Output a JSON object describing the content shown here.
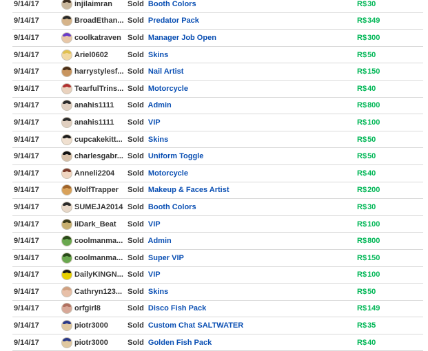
{
  "colors": {
    "item_link": "#0a4fb3",
    "robux": "#02b757",
    "divider": "#d9d9d9"
  },
  "sales": [
    {
      "date": "9/14/17",
      "user": "injilaimran",
      "action": "Sold",
      "item": "Booth Colors",
      "currency": "R$",
      "amount": "30",
      "avatar": {
        "skin": "#c9b79c",
        "hair": "#3b2d20"
      }
    },
    {
      "date": "9/14/17",
      "user": "BroadEthan...",
      "action": "Sold",
      "item": "Predator Pack",
      "currency": "R$",
      "amount": "349",
      "avatar": {
        "skin": "#d6b48a",
        "hair": "#2a2a2a"
      }
    },
    {
      "date": "9/14/17",
      "user": "coolkatraven",
      "action": "Sold",
      "item": "Manager Job Open",
      "currency": "R$",
      "amount": "300",
      "avatar": {
        "skin": "#e8c7a7",
        "hair": "#6a3ec9"
      }
    },
    {
      "date": "9/14/17",
      "user": "Ariel0602",
      "action": "Sold",
      "item": "Skins",
      "currency": "R$",
      "amount": "50",
      "avatar": {
        "skin": "#f2d8a0",
        "hair": "#e0c050"
      }
    },
    {
      "date": "9/14/17",
      "user": "harrystylesf...",
      "action": "Sold",
      "item": "Nail Artist",
      "currency": "R$",
      "amount": "150",
      "avatar": {
        "skin": "#c8955f",
        "hair": "#4a2f18"
      }
    },
    {
      "date": "9/14/17",
      "user": "TearfulTrins...",
      "action": "Sold",
      "item": "Motorcycle",
      "currency": "R$",
      "amount": "40",
      "avatar": {
        "skin": "#ead2be",
        "hair": "#b03030"
      }
    },
    {
      "date": "9/14/17",
      "user": "anahis1111",
      "action": "Sold",
      "item": "Admin",
      "currency": "R$",
      "amount": "800",
      "avatar": {
        "skin": "#e0cfc0",
        "hair": "#2b2b2b"
      }
    },
    {
      "date": "9/14/17",
      "user": "anahis1111",
      "action": "Sold",
      "item": "VIP",
      "currency": "R$",
      "amount": "100",
      "avatar": {
        "skin": "#e0cfc0",
        "hair": "#2b2b2b"
      }
    },
    {
      "date": "9/14/17",
      "user": "cupcakekitt...",
      "action": "Sold",
      "item": "Skins",
      "currency": "R$",
      "amount": "50",
      "avatar": {
        "skin": "#f0e0d0",
        "hair": "#1d1d1d"
      }
    },
    {
      "date": "9/14/17",
      "user": "charlesgabr...",
      "action": "Sold",
      "item": "Uniform Toggle",
      "currency": "R$",
      "amount": "50",
      "avatar": {
        "skin": "#d8c0a8",
        "hair": "#111111"
      }
    },
    {
      "date": "9/14/17",
      "user": "Anneli2204",
      "action": "Sold",
      "item": "Motorcycle",
      "currency": "R$",
      "amount": "40",
      "avatar": {
        "skin": "#f0d5c0",
        "hair": "#7a3a2a"
      }
    },
    {
      "date": "9/14/17",
      "user": "WolfTrapper",
      "action": "Sold",
      "item": "Makeup & Faces Artist",
      "currency": "R$",
      "amount": "200",
      "avatar": {
        "skin": "#d9a25a",
        "hair": "#a0642a"
      }
    },
    {
      "date": "9/14/17",
      "user": "SUMEJA2014",
      "action": "Sold",
      "item": "Booth Colors",
      "currency": "R$",
      "amount": "30",
      "avatar": {
        "skin": "#e8d8c8",
        "hair": "#2a2a2a"
      }
    },
    {
      "date": "9/14/17",
      "user": "iiDark_Beat",
      "action": "Sold",
      "item": "VIP",
      "currency": "R$",
      "amount": "100",
      "avatar": {
        "skin": "#c8b070",
        "hair": "#3a3a1a"
      }
    },
    {
      "date": "9/14/17",
      "user": "coolmanma...",
      "action": "Sold",
      "item": "Admin",
      "currency": "R$",
      "amount": "800",
      "avatar": {
        "skin": "#6aa84f",
        "hair": "#2a4a1a"
      }
    },
    {
      "date": "9/14/17",
      "user": "coolmanma...",
      "action": "Sold",
      "item": "Super VIP",
      "currency": "R$",
      "amount": "150",
      "avatar": {
        "skin": "#6aa84f",
        "hair": "#2a4a1a"
      }
    },
    {
      "date": "9/14/17",
      "user": "DailyKINGN...",
      "action": "Sold",
      "item": "VIP",
      "currency": "R$",
      "amount": "100",
      "avatar": {
        "skin": "#e8d000",
        "hair": "#1a1a1a"
      }
    },
    {
      "date": "9/14/17",
      "user": "Cathryn123...",
      "action": "Sold",
      "item": "Skins",
      "currency": "R$",
      "amount": "50",
      "avatar": {
        "skin": "#e8c0a8",
        "hair": "#d0a080"
      }
    },
    {
      "date": "9/14/17",
      "user": "orfgirl8",
      "action": "Sold",
      "item": "Disco Fish Pack",
      "currency": "R$",
      "amount": "149",
      "avatar": {
        "skin": "#d8a898",
        "hair": "#b07060"
      }
    },
    {
      "date": "9/14/17",
      "user": "piotr3000",
      "action": "Sold",
      "item": "Custom Chat SALTWATER",
      "currency": "R$",
      "amount": "35",
      "avatar": {
        "skin": "#e0c8a0",
        "hair": "#2a3a8a"
      }
    },
    {
      "date": "9/14/17",
      "user": "piotr3000",
      "action": "Sold",
      "item": "Golden Fish Pack",
      "currency": "R$",
      "amount": "40",
      "avatar": {
        "skin": "#e0c8a0",
        "hair": "#2a3a8a"
      }
    }
  ]
}
